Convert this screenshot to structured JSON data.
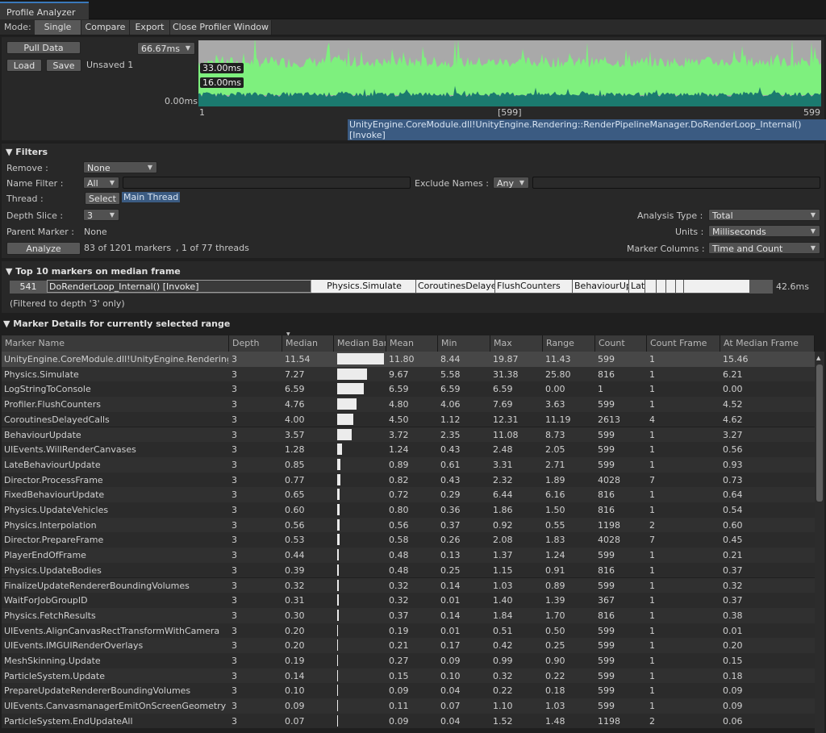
{
  "window_tab": "Profile Analyzer",
  "mode": {
    "label": "Mode:",
    "tabs": [
      "Single",
      "Compare",
      "Export",
      "Close Profiler Window"
    ]
  },
  "top": {
    "pull_data": "Pull Data",
    "load": "Load",
    "save": "Save",
    "unsaved": "Unsaved 1",
    "scale_dropdown": "66.67ms",
    "line_33": "33.00ms",
    "line_16": "16.00ms",
    "zero": "0.00ms",
    "axis_start": "1",
    "axis_mid": "[599]",
    "axis_end": "599",
    "selected_marker": "UnityEngine.CoreModule.dll!UnityEngine.Rendering::RenderPipelineManager.DoRenderLoop_Internal() [Invoke]",
    "graph_colors": {
      "background": "#a9a9a9",
      "bars": "#7ef07e",
      "floor": "#1b7a6f"
    }
  },
  "filters": {
    "title": "Filters",
    "remove_label": "Remove :",
    "remove_value": "None",
    "name_filter_label": "Name Filter :",
    "name_filter_value": "All",
    "exclude_label": "Exclude Names :",
    "exclude_value": "Any",
    "thread_label": "Thread :",
    "thread_select": "Select",
    "thread_value": "Main Thread",
    "depth_label": "Depth Slice :",
    "depth_value": "3",
    "parent_label": "Parent Marker :",
    "parent_value": "None",
    "analyze": "Analyze",
    "marker_count": "83 of 1201 markers",
    "thread_count": ", 1 of 77 threads",
    "analysis_type_label": "Analysis Type :",
    "analysis_type_value": "Total",
    "units_label": "Units :",
    "units_value": "Milliseconds",
    "marker_columns_label": "Marker Columns :",
    "marker_columns_value": "Time and Count"
  },
  "top10": {
    "title": "Top 10 markers on median frame",
    "frame": "541",
    "segments": [
      "DoRenderLoop_Internal() [Invoke]",
      "Physics.Simulate",
      "CoroutinesDelaye",
      "FlushCounters",
      "BehaviourUp",
      "Lat",
      "",
      "",
      "",
      "",
      ""
    ],
    "total": "42.6ms",
    "note": "(Filtered to depth '3' only)"
  },
  "details": {
    "title": "Marker Details for currently selected range",
    "sort_indicator": "▼",
    "columns": [
      "Marker Name",
      "Depth",
      "Median",
      "Median Bar",
      "Mean",
      "Min",
      "Max",
      "Range",
      "Count",
      "Count Frame",
      "At Median Frame"
    ],
    "rows": [
      {
        "name": "UnityEngine.CoreModule.dll!UnityEngine.Rendering::",
        "depth": "3",
        "median": "11.54",
        "bar": 1.0,
        "mean": "11.80",
        "min": "8.44",
        "max": "19.87",
        "range": "11.43",
        "count": "599",
        "count_frame": "1",
        "at_median": "15.46"
      },
      {
        "name": "Physics.Simulate",
        "depth": "3",
        "median": "7.27",
        "bar": 0.63,
        "mean": "9.67",
        "min": "5.58",
        "max": "31.38",
        "range": "25.80",
        "count": "816",
        "count_frame": "1",
        "at_median": "6.21"
      },
      {
        "name": "LogStringToConsole",
        "depth": "3",
        "median": "6.59",
        "bar": 0.571,
        "mean": "6.59",
        "min": "6.59",
        "max": "6.59",
        "range": "0.00",
        "count": "1",
        "count_frame": "1",
        "at_median": "0.00"
      },
      {
        "name": "Profiler.FlushCounters",
        "depth": "3",
        "median": "4.76",
        "bar": 0.412,
        "mean": "4.80",
        "min": "4.06",
        "max": "7.69",
        "range": "3.63",
        "count": "599",
        "count_frame": "1",
        "at_median": "4.52"
      },
      {
        "name": "CoroutinesDelayedCalls",
        "depth": "3",
        "median": "4.00",
        "bar": 0.347,
        "mean": "4.50",
        "min": "1.12",
        "max": "12.31",
        "range": "11.19",
        "count": "2613",
        "count_frame": "4",
        "at_median": "4.62"
      },
      {
        "name": "BehaviourUpdate",
        "depth": "3",
        "median": "3.57",
        "bar": 0.309,
        "mean": "3.72",
        "min": "2.35",
        "max": "11.08",
        "range": "8.73",
        "count": "599",
        "count_frame": "1",
        "at_median": "3.27"
      },
      {
        "name": "UIEvents.WillRenderCanvases",
        "depth": "3",
        "median": "1.28",
        "bar": 0.111,
        "mean": "1.24",
        "min": "0.43",
        "max": "2.48",
        "range": "2.05",
        "count": "599",
        "count_frame": "1",
        "at_median": "0.56"
      },
      {
        "name": "LateBehaviourUpdate",
        "depth": "3",
        "median": "0.85",
        "bar": 0.074,
        "mean": "0.89",
        "min": "0.61",
        "max": "3.31",
        "range": "2.71",
        "count": "599",
        "count_frame": "1",
        "at_median": "0.93"
      },
      {
        "name": "Director.ProcessFrame",
        "depth": "3",
        "median": "0.77",
        "bar": 0.067,
        "mean": "0.82",
        "min": "0.43",
        "max": "2.32",
        "range": "1.89",
        "count": "4028",
        "count_frame": "7",
        "at_median": "0.73"
      },
      {
        "name": "FixedBehaviourUpdate",
        "depth": "3",
        "median": "0.65",
        "bar": 0.056,
        "mean": "0.72",
        "min": "0.29",
        "max": "6.44",
        "range": "6.16",
        "count": "816",
        "count_frame": "1",
        "at_median": "0.64"
      },
      {
        "name": "Physics.UpdateVehicles",
        "depth": "3",
        "median": "0.60",
        "bar": 0.052,
        "mean": "0.80",
        "min": "0.36",
        "max": "1.86",
        "range": "1.50",
        "count": "816",
        "count_frame": "1",
        "at_median": "0.54"
      },
      {
        "name": "Physics.Interpolation",
        "depth": "3",
        "median": "0.56",
        "bar": 0.049,
        "mean": "0.56",
        "min": "0.37",
        "max": "0.92",
        "range": "0.55",
        "count": "1198",
        "count_frame": "2",
        "at_median": "0.60"
      },
      {
        "name": "Director.PrepareFrame",
        "depth": "3",
        "median": "0.53",
        "bar": 0.046,
        "mean": "0.58",
        "min": "0.26",
        "max": "2.08",
        "range": "1.83",
        "count": "4028",
        "count_frame": "7",
        "at_median": "0.45"
      },
      {
        "name": "PlayerEndOfFrame",
        "depth": "3",
        "median": "0.44",
        "bar": 0.038,
        "mean": "0.48",
        "min": "0.13",
        "max": "1.37",
        "range": "1.24",
        "count": "599",
        "count_frame": "1",
        "at_median": "0.21"
      },
      {
        "name": "Physics.UpdateBodies",
        "depth": "3",
        "median": "0.39",
        "bar": 0.034,
        "mean": "0.48",
        "min": "0.25",
        "max": "1.15",
        "range": "0.91",
        "count": "816",
        "count_frame": "1",
        "at_median": "0.37"
      },
      {
        "name": "FinalizeUpdateRendererBoundingVolumes",
        "depth": "3",
        "median": "0.32",
        "bar": 0.028,
        "mean": "0.32",
        "min": "0.14",
        "max": "1.03",
        "range": "0.89",
        "count": "599",
        "count_frame": "1",
        "at_median": "0.32"
      },
      {
        "name": "WaitForJobGroupID",
        "depth": "3",
        "median": "0.31",
        "bar": 0.027,
        "mean": "0.32",
        "min": "0.01",
        "max": "1.40",
        "range": "1.39",
        "count": "367",
        "count_frame": "1",
        "at_median": "0.37"
      },
      {
        "name": "Physics.FetchResults",
        "depth": "3",
        "median": "0.30",
        "bar": 0.026,
        "mean": "0.37",
        "min": "0.14",
        "max": "1.84",
        "range": "1.70",
        "count": "816",
        "count_frame": "1",
        "at_median": "0.38"
      },
      {
        "name": "UIEvents.AlignCanvasRectTransformWithCamera",
        "depth": "3",
        "median": "0.20",
        "bar": 0.017,
        "mean": "0.19",
        "min": "0.01",
        "max": "0.51",
        "range": "0.50",
        "count": "599",
        "count_frame": "1",
        "at_median": "0.01"
      },
      {
        "name": "UIEvents.IMGUIRenderOverlays",
        "depth": "3",
        "median": "0.20",
        "bar": 0.017,
        "mean": "0.21",
        "min": "0.17",
        "max": "0.42",
        "range": "0.25",
        "count": "599",
        "count_frame": "1",
        "at_median": "0.20"
      },
      {
        "name": "MeshSkinning.Update",
        "depth": "3",
        "median": "0.19",
        "bar": 0.016,
        "mean": "0.27",
        "min": "0.09",
        "max": "0.99",
        "range": "0.90",
        "count": "599",
        "count_frame": "1",
        "at_median": "0.15"
      },
      {
        "name": "ParticleSystem.Update",
        "depth": "3",
        "median": "0.14",
        "bar": 0.012,
        "mean": "0.15",
        "min": "0.10",
        "max": "0.32",
        "range": "0.22",
        "count": "599",
        "count_frame": "1",
        "at_median": "0.18"
      },
      {
        "name": "PrepareUpdateRendererBoundingVolumes",
        "depth": "3",
        "median": "0.10",
        "bar": 0.009,
        "mean": "0.09",
        "min": "0.04",
        "max": "0.22",
        "range": "0.18",
        "count": "599",
        "count_frame": "1",
        "at_median": "0.09"
      },
      {
        "name": "UIEvents.CanvasmanagerEmitOnScreenGeometry",
        "depth": "3",
        "median": "0.09",
        "bar": 0.008,
        "mean": "0.11",
        "min": "0.07",
        "max": "1.10",
        "range": "1.03",
        "count": "599",
        "count_frame": "1",
        "at_median": "0.09"
      },
      {
        "name": "ParticleSystem.EndUpdateAll",
        "depth": "3",
        "median": "0.07",
        "bar": 0.006,
        "mean": "0.09",
        "min": "0.04",
        "max": "1.52",
        "range": "1.48",
        "count": "1198",
        "count_frame": "2",
        "at_median": "0.06"
      }
    ]
  }
}
